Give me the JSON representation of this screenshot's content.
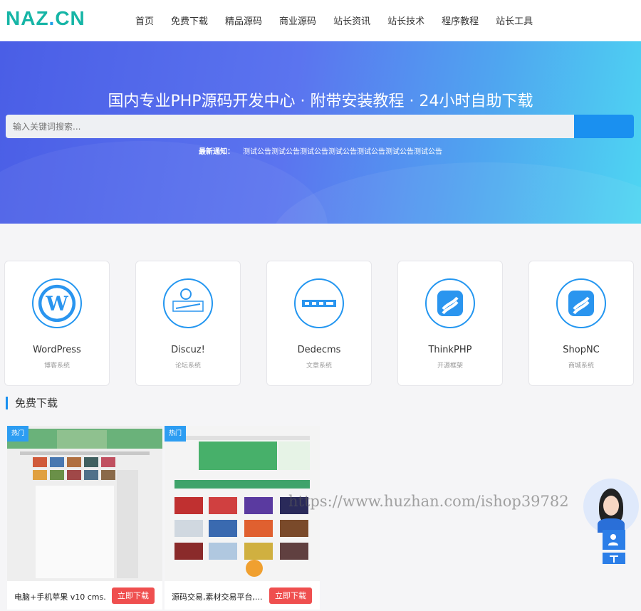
{
  "logo": {
    "text_a": "NAZ",
    "text_dot": ".",
    "text_b": "CN"
  },
  "nav": [
    "首页",
    "免费下载",
    "精品源码",
    "商业源码",
    "站长资讯",
    "站长技术",
    "程序教程",
    "站长工具"
  ],
  "hero": {
    "title": "国内专业PHP源码开发中心 · 附带安装教程 · 24小时自助下载",
    "search_placeholder": "输入关键词搜索...",
    "notice_label": "最新通知：",
    "notice_text": "测试公告测试公告测试公告测试公告测试公告测试公告测试公告"
  },
  "categories": [
    {
      "name": "WordPress",
      "sub": "博客系统",
      "icon": "wordpress-icon"
    },
    {
      "name": "Discuz!",
      "sub": "论坛系统",
      "icon": "discuz-icon"
    },
    {
      "name": "Dedecms",
      "sub": "文章系统",
      "icon": "dedecms-icon"
    },
    {
      "name": "ThinkPHP",
      "sub": "开源框架",
      "icon": "thinkphp-icon"
    },
    {
      "name": "ShopNC",
      "sub": "商城系统",
      "icon": "shopnc-icon"
    }
  ],
  "section": {
    "title": "免费下载"
  },
  "cards": [
    {
      "badge": "热门",
      "title": "电脑+手机苹果 v10 cms...",
      "button": "立即下载"
    },
    {
      "badge": "热门",
      "title": "源码交易,素材交易平台,...",
      "button": "立即下载"
    }
  ],
  "watermark": "https://www.huzhan.com/ishop39782",
  "colors": {
    "accent": "#1a90f0",
    "logo": "#16b5a6",
    "download": "#ef4f4f"
  }
}
